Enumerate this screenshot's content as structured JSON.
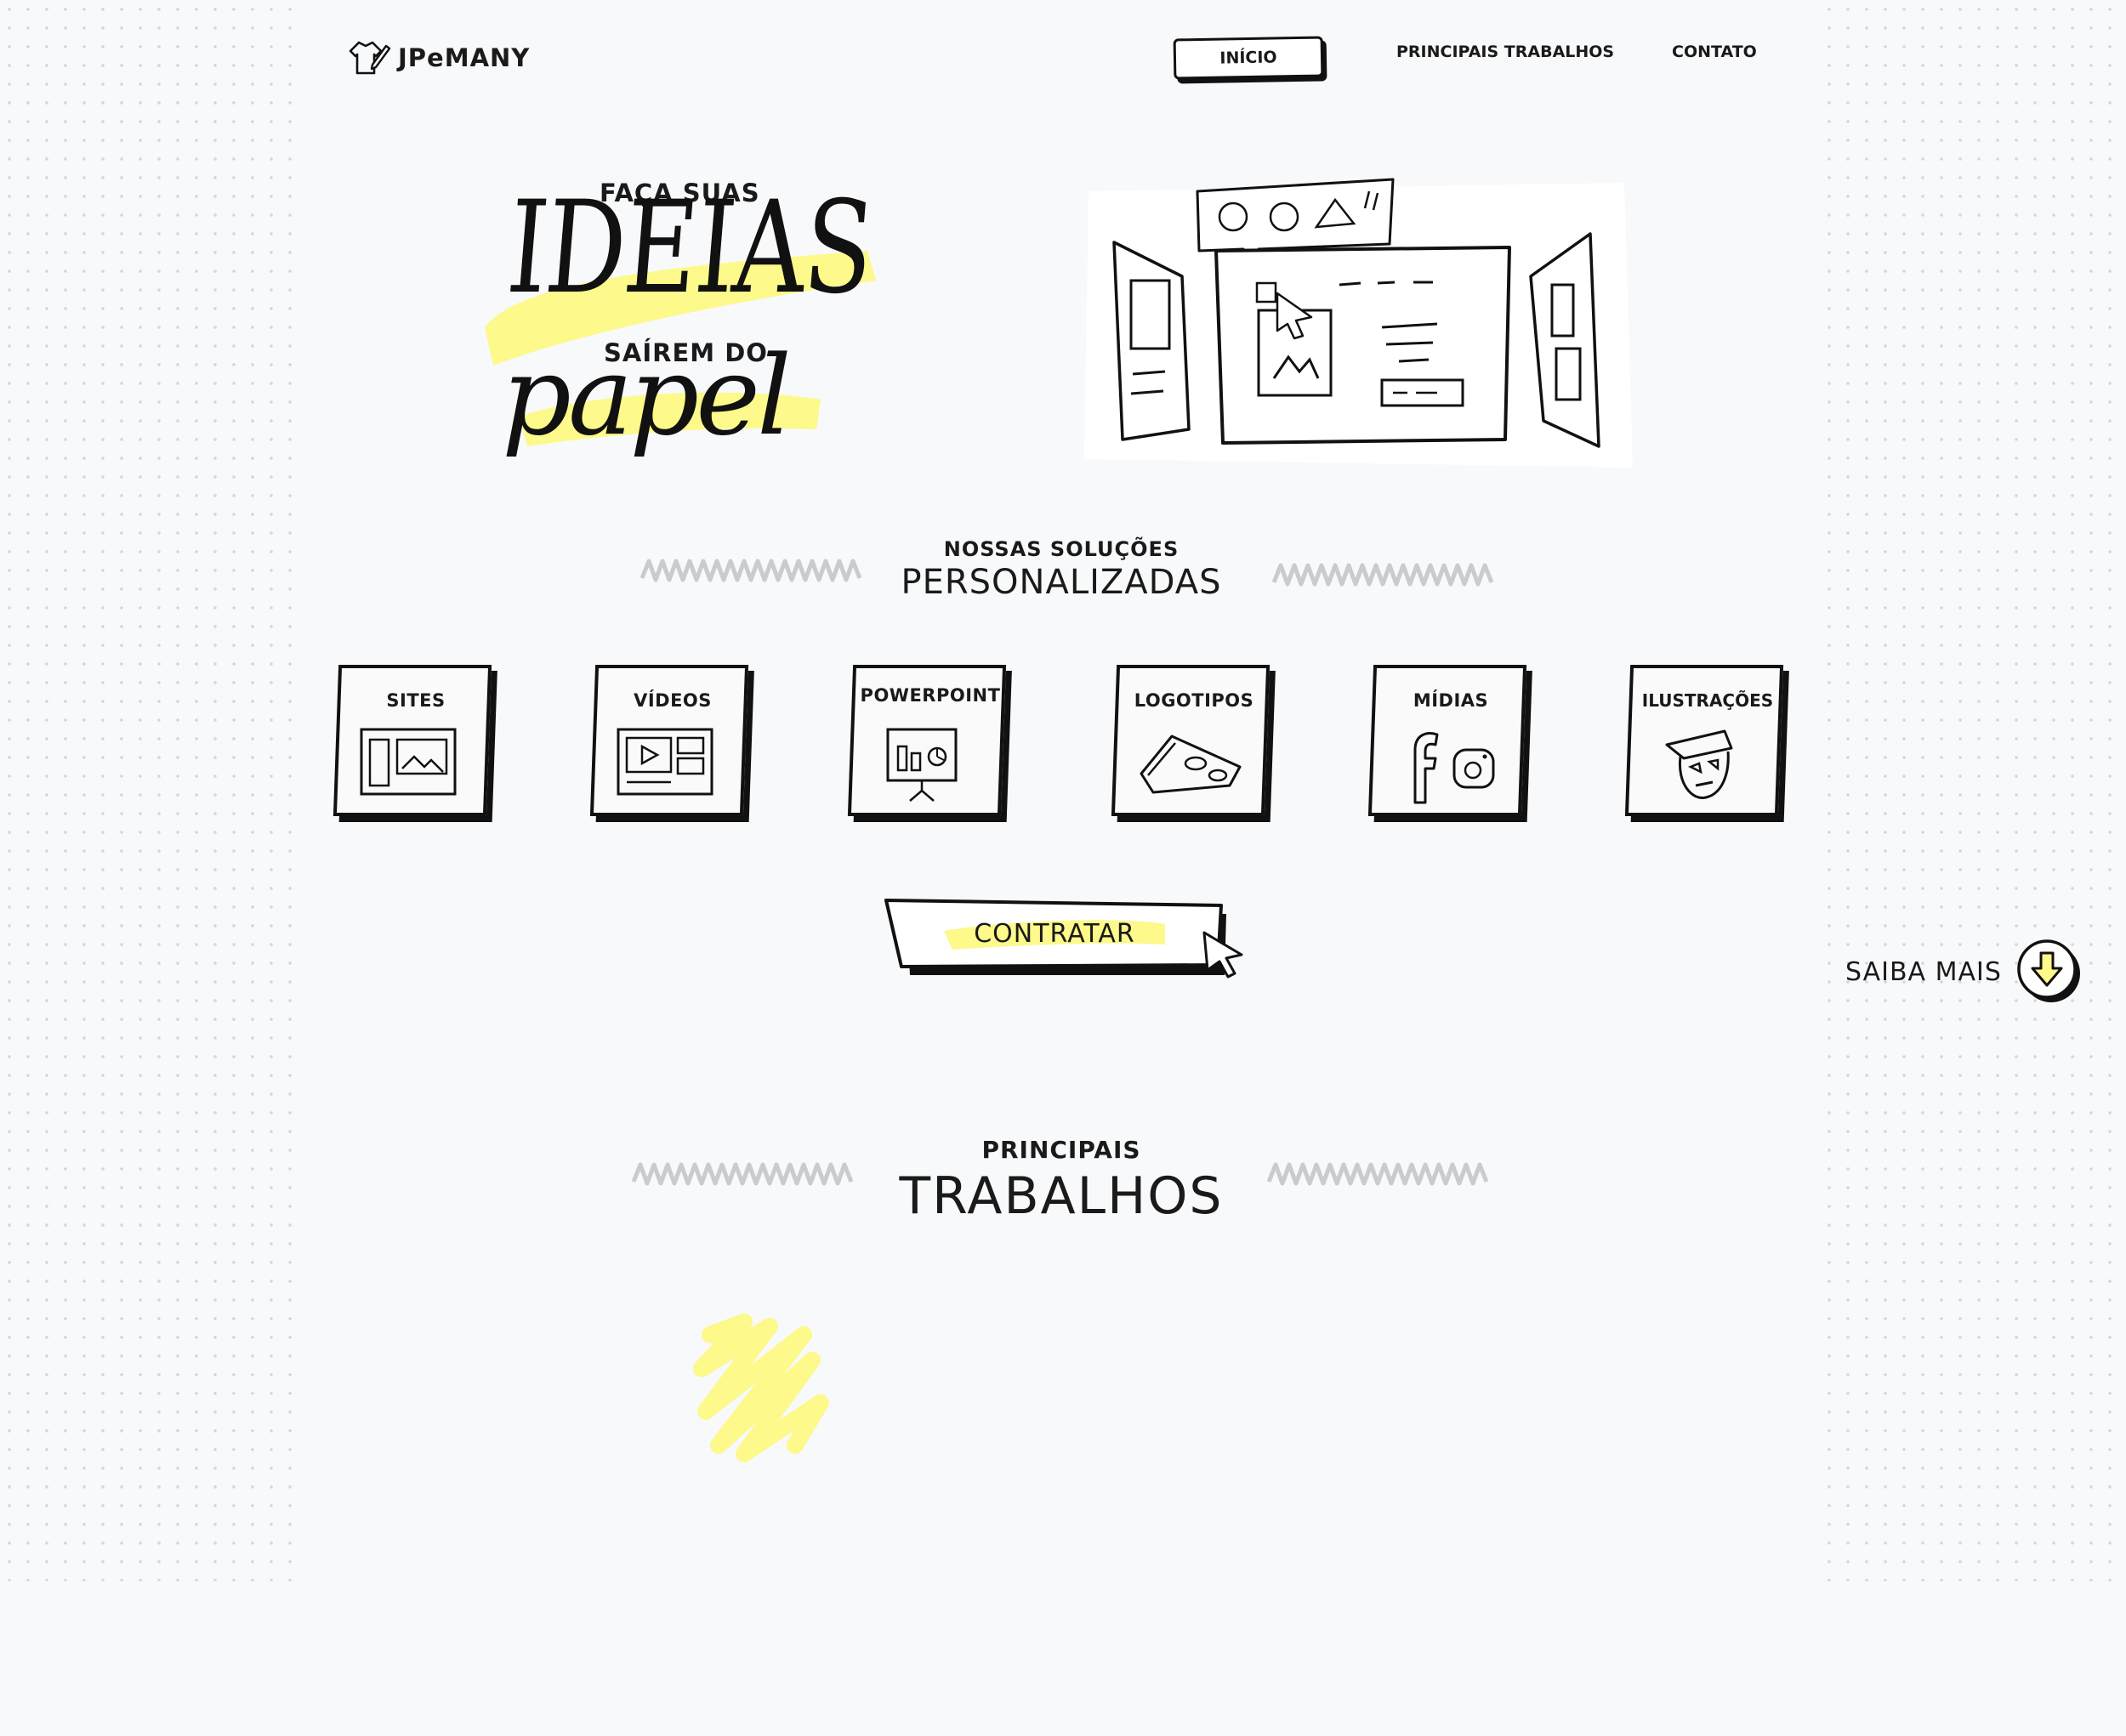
{
  "header": {
    "logo_text": "JPeMANY",
    "nav": {
      "inicio": "INÍCIO",
      "trabalhos": "PRINCIPAIS TRABALHOS",
      "contato": "CONTATO"
    }
  },
  "hero": {
    "line1": "FAÇA SUAS",
    "line2": "IDEIAS",
    "line3": "SAÍREM DO",
    "line4": "papel"
  },
  "solutions": {
    "subtitle": "NOSSAS SOLUÇÕES",
    "title": "PERSONALIZADAS",
    "cards": [
      "SITES",
      "VÍDEOS",
      "POWERPOINT",
      "LOGOTIPOS",
      "MÍDIAS",
      "ILUSTRAÇÕES"
    ]
  },
  "cta": {
    "label": "CONTRATAR"
  },
  "saiba_mais": {
    "label": "SAIBA MAIS"
  },
  "works": {
    "subtitle": "PRINCIPAIS",
    "title": "TRABALHOS"
  },
  "colors": {
    "highlight": "#fdf98a",
    "ink": "#111111",
    "background": "#f8f9fb",
    "squiggle": "#c9cbcf"
  }
}
